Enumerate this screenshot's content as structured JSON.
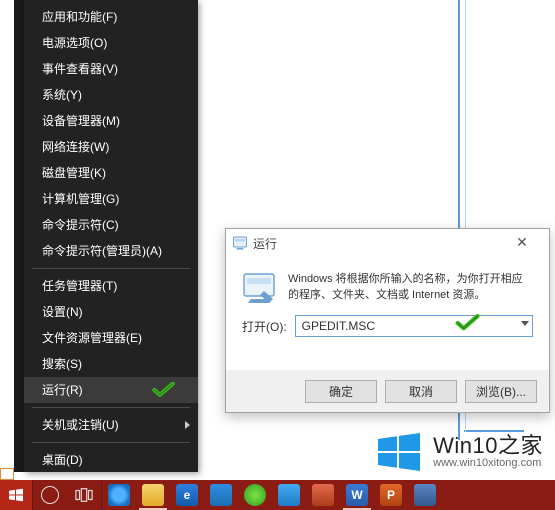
{
  "menu": {
    "items": [
      {
        "label": "应用和功能(F)"
      },
      {
        "label": "电源选项(O)"
      },
      {
        "label": "事件查看器(V)"
      },
      {
        "label": "系统(Y)"
      },
      {
        "label": "设备管理器(M)"
      },
      {
        "label": "网络连接(W)"
      },
      {
        "label": "磁盘管理(K)"
      },
      {
        "label": "计算机管理(G)"
      },
      {
        "label": "命令提示符(C)"
      },
      {
        "label": "命令提示符(管理员)(A)"
      }
    ],
    "items2": [
      {
        "label": "任务管理器(T)"
      },
      {
        "label": "设置(N)"
      },
      {
        "label": "文件资源管理器(E)"
      },
      {
        "label": "搜索(S)"
      },
      {
        "label": "运行(R)"
      }
    ],
    "items3": [
      {
        "label": "关机或注销(U)"
      }
    ],
    "items4": [
      {
        "label": "桌面(D)"
      }
    ]
  },
  "run": {
    "title": "运行",
    "desc": "Windows 将根据你所输入的名称，为你打开相应的程序、文件夹、文档或 Internet 资源。",
    "open_label": "打开(O):",
    "value": "GPEDIT.MSC",
    "placeholder": "",
    "ok": "确定",
    "cancel": "取消",
    "browse": "浏览(B)..."
  },
  "watermark": {
    "line1": "Win10之家",
    "line2": "www.win10xitong.com"
  },
  "taskbar": {
    "apps": [
      {
        "name": "ie"
      },
      {
        "name": "file-explorer"
      },
      {
        "name": "edge"
      },
      {
        "name": "store"
      },
      {
        "name": "app-green"
      },
      {
        "name": "app-blue"
      },
      {
        "name": "app-red"
      },
      {
        "name": "word"
      },
      {
        "name": "ppt"
      },
      {
        "name": "misc"
      }
    ]
  }
}
